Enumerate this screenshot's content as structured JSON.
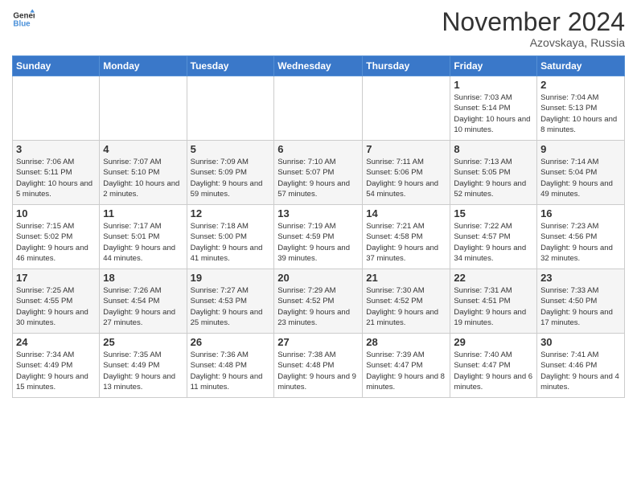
{
  "logo": {
    "line1": "General",
    "line2": "Blue"
  },
  "title": "November 2024",
  "location": "Azovskaya, Russia",
  "days_of_week": [
    "Sunday",
    "Monday",
    "Tuesday",
    "Wednesday",
    "Thursday",
    "Friday",
    "Saturday"
  ],
  "weeks": [
    [
      {
        "day": "",
        "info": ""
      },
      {
        "day": "",
        "info": ""
      },
      {
        "day": "",
        "info": ""
      },
      {
        "day": "",
        "info": ""
      },
      {
        "day": "",
        "info": ""
      },
      {
        "day": "1",
        "info": "Sunrise: 7:03 AM\nSunset: 5:14 PM\nDaylight: 10 hours and 10 minutes."
      },
      {
        "day": "2",
        "info": "Sunrise: 7:04 AM\nSunset: 5:13 PM\nDaylight: 10 hours and 8 minutes."
      }
    ],
    [
      {
        "day": "3",
        "info": "Sunrise: 7:06 AM\nSunset: 5:11 PM\nDaylight: 10 hours and 5 minutes."
      },
      {
        "day": "4",
        "info": "Sunrise: 7:07 AM\nSunset: 5:10 PM\nDaylight: 10 hours and 2 minutes."
      },
      {
        "day": "5",
        "info": "Sunrise: 7:09 AM\nSunset: 5:09 PM\nDaylight: 9 hours and 59 minutes."
      },
      {
        "day": "6",
        "info": "Sunrise: 7:10 AM\nSunset: 5:07 PM\nDaylight: 9 hours and 57 minutes."
      },
      {
        "day": "7",
        "info": "Sunrise: 7:11 AM\nSunset: 5:06 PM\nDaylight: 9 hours and 54 minutes."
      },
      {
        "day": "8",
        "info": "Sunrise: 7:13 AM\nSunset: 5:05 PM\nDaylight: 9 hours and 52 minutes."
      },
      {
        "day": "9",
        "info": "Sunrise: 7:14 AM\nSunset: 5:04 PM\nDaylight: 9 hours and 49 minutes."
      }
    ],
    [
      {
        "day": "10",
        "info": "Sunrise: 7:15 AM\nSunset: 5:02 PM\nDaylight: 9 hours and 46 minutes."
      },
      {
        "day": "11",
        "info": "Sunrise: 7:17 AM\nSunset: 5:01 PM\nDaylight: 9 hours and 44 minutes."
      },
      {
        "day": "12",
        "info": "Sunrise: 7:18 AM\nSunset: 5:00 PM\nDaylight: 9 hours and 41 minutes."
      },
      {
        "day": "13",
        "info": "Sunrise: 7:19 AM\nSunset: 4:59 PM\nDaylight: 9 hours and 39 minutes."
      },
      {
        "day": "14",
        "info": "Sunrise: 7:21 AM\nSunset: 4:58 PM\nDaylight: 9 hours and 37 minutes."
      },
      {
        "day": "15",
        "info": "Sunrise: 7:22 AM\nSunset: 4:57 PM\nDaylight: 9 hours and 34 minutes."
      },
      {
        "day": "16",
        "info": "Sunrise: 7:23 AM\nSunset: 4:56 PM\nDaylight: 9 hours and 32 minutes."
      }
    ],
    [
      {
        "day": "17",
        "info": "Sunrise: 7:25 AM\nSunset: 4:55 PM\nDaylight: 9 hours and 30 minutes."
      },
      {
        "day": "18",
        "info": "Sunrise: 7:26 AM\nSunset: 4:54 PM\nDaylight: 9 hours and 27 minutes."
      },
      {
        "day": "19",
        "info": "Sunrise: 7:27 AM\nSunset: 4:53 PM\nDaylight: 9 hours and 25 minutes."
      },
      {
        "day": "20",
        "info": "Sunrise: 7:29 AM\nSunset: 4:52 PM\nDaylight: 9 hours and 23 minutes."
      },
      {
        "day": "21",
        "info": "Sunrise: 7:30 AM\nSunset: 4:52 PM\nDaylight: 9 hours and 21 minutes."
      },
      {
        "day": "22",
        "info": "Sunrise: 7:31 AM\nSunset: 4:51 PM\nDaylight: 9 hours and 19 minutes."
      },
      {
        "day": "23",
        "info": "Sunrise: 7:33 AM\nSunset: 4:50 PM\nDaylight: 9 hours and 17 minutes."
      }
    ],
    [
      {
        "day": "24",
        "info": "Sunrise: 7:34 AM\nSunset: 4:49 PM\nDaylight: 9 hours and 15 minutes."
      },
      {
        "day": "25",
        "info": "Sunrise: 7:35 AM\nSunset: 4:49 PM\nDaylight: 9 hours and 13 minutes."
      },
      {
        "day": "26",
        "info": "Sunrise: 7:36 AM\nSunset: 4:48 PM\nDaylight: 9 hours and 11 minutes."
      },
      {
        "day": "27",
        "info": "Sunrise: 7:38 AM\nSunset: 4:48 PM\nDaylight: 9 hours and 9 minutes."
      },
      {
        "day": "28",
        "info": "Sunrise: 7:39 AM\nSunset: 4:47 PM\nDaylight: 9 hours and 8 minutes."
      },
      {
        "day": "29",
        "info": "Sunrise: 7:40 AM\nSunset: 4:47 PM\nDaylight: 9 hours and 6 minutes."
      },
      {
        "day": "30",
        "info": "Sunrise: 7:41 AM\nSunset: 4:46 PM\nDaylight: 9 hours and 4 minutes."
      }
    ]
  ]
}
